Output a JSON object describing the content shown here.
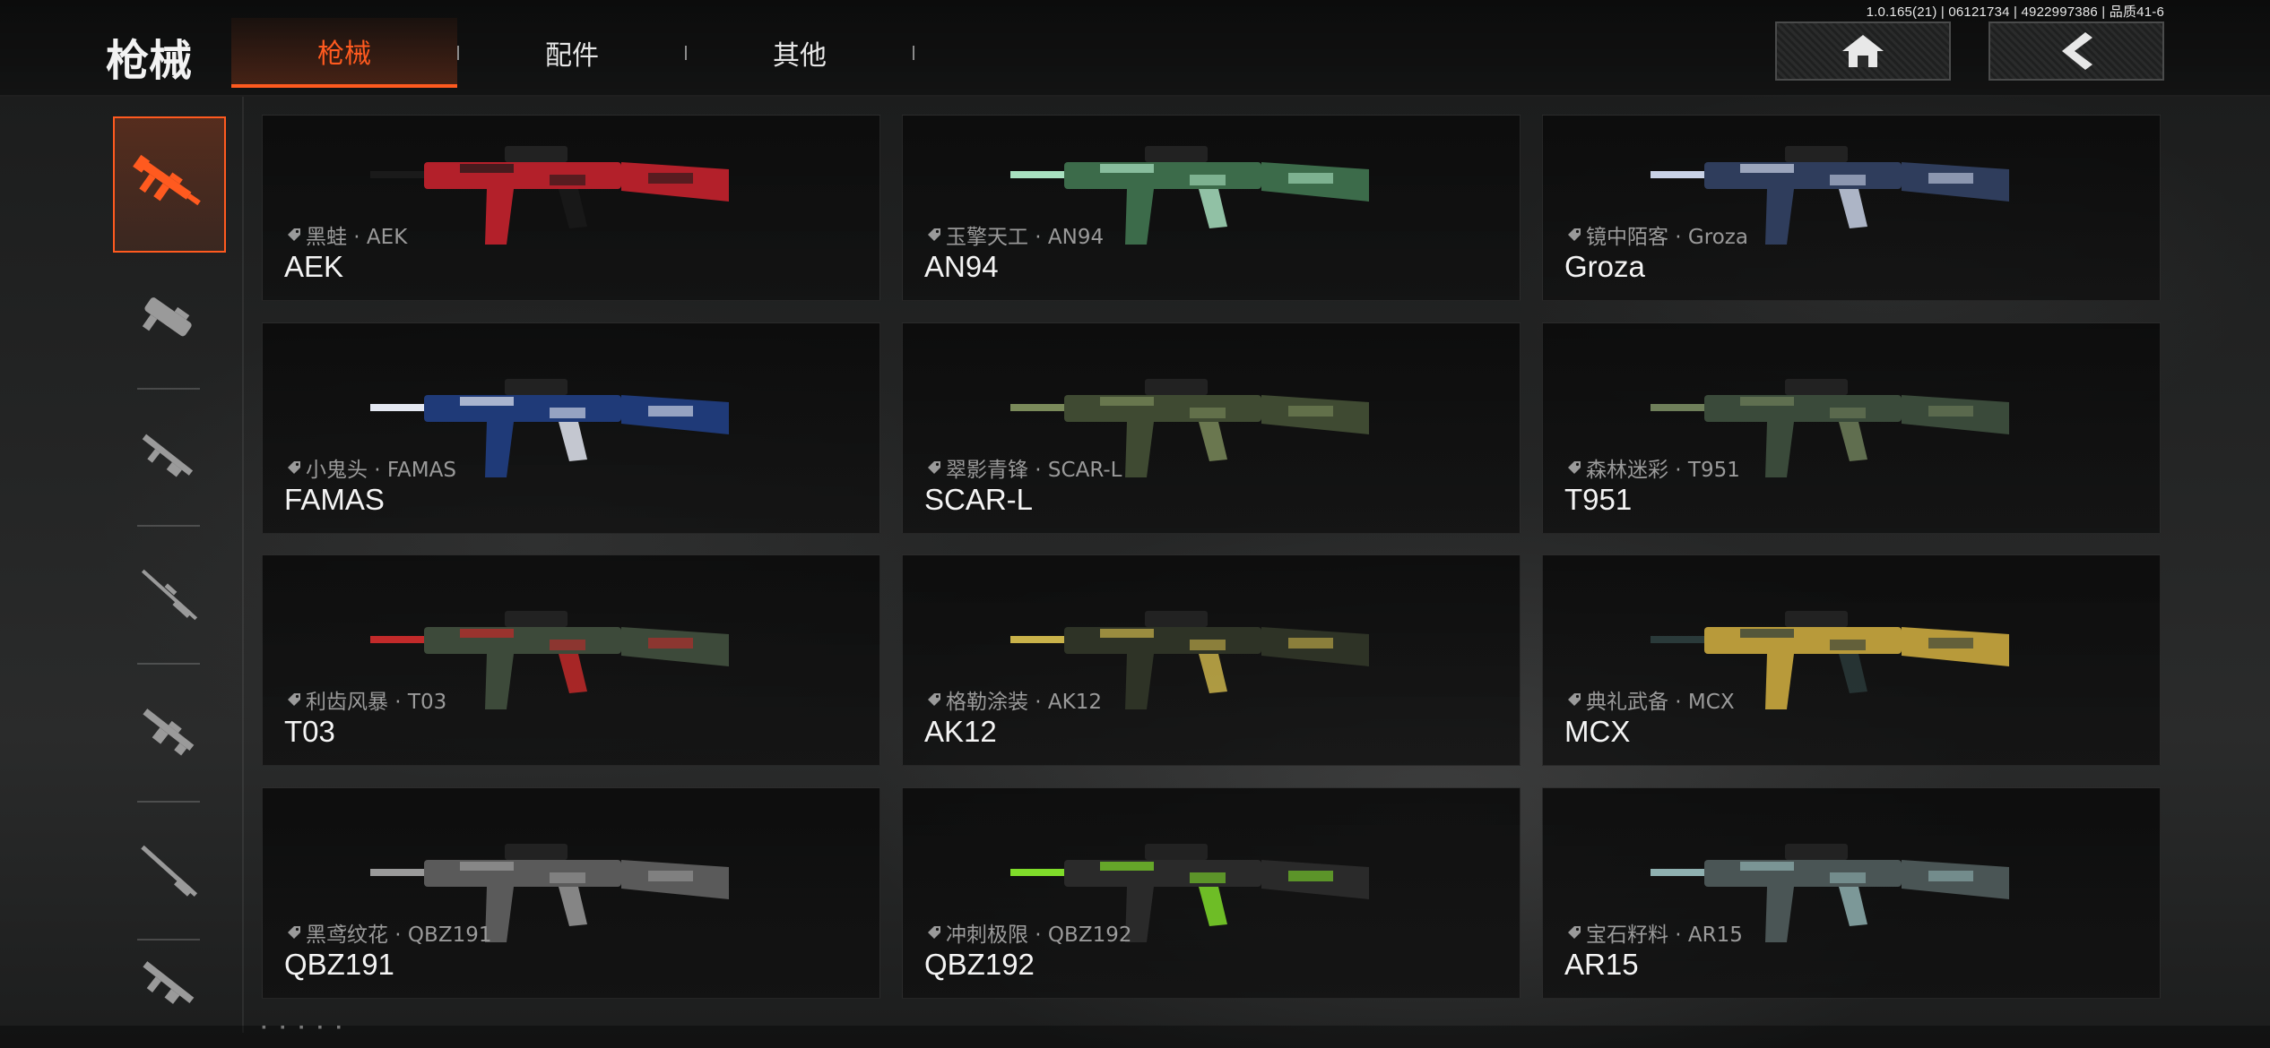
{
  "version": "1.0.165(21) | 06121734 | 4922997386 | 品质41-6",
  "header": {
    "title": "枪械",
    "tabs": [
      {
        "label": "枪械",
        "active": true
      },
      {
        "label": "配件",
        "active": false
      },
      {
        "label": "其他",
        "active": false
      }
    ],
    "home_icon": "home-icon",
    "back_icon": "chevron-left-icon"
  },
  "colors": {
    "accent": "#ff5a1f",
    "text": "#f4f4f4",
    "muted": "#9a9a9a"
  },
  "sidebar": {
    "items": [
      {
        "icon": "assault-rifle-icon",
        "active": true
      },
      {
        "icon": "smg-icon",
        "active": false
      },
      {
        "icon": "carbine-icon",
        "active": false
      },
      {
        "icon": "sniper-rifle-icon",
        "active": false
      },
      {
        "icon": "lmg-icon",
        "active": false
      },
      {
        "icon": "shotgun-icon",
        "active": false
      },
      {
        "icon": "pistol-icon",
        "active": false
      }
    ]
  },
  "weapons": [
    {
      "skin": "黑蛙 · AEK",
      "name": "AEK",
      "palette": [
        "#b3202a",
        "#1a1a1a"
      ]
    },
    {
      "skin": "玉擎天工 · AN94",
      "name": "AN94",
      "palette": [
        "#3c6b4a",
        "#a8e0c0"
      ]
    },
    {
      "skin": "镜中陌客 · Groza",
      "name": "Groza",
      "palette": [
        "#2f3d5c",
        "#c9d2e6"
      ]
    },
    {
      "skin": "小鬼头 · FAMAS",
      "name": "FAMAS",
      "palette": [
        "#1f3a78",
        "#e4e8f2"
      ]
    },
    {
      "skin": "翠影青锋 · SCAR-L",
      "name": "SCAR-L",
      "palette": [
        "#3f4a32",
        "#7a8a5a"
      ]
    },
    {
      "skin": "森林迷彩 · T951",
      "name": "T951",
      "palette": [
        "#3a4a3a",
        "#6f7f5a"
      ]
    },
    {
      "skin": "利齿风暴 · T03",
      "name": "T03",
      "palette": [
        "#3d4a3a",
        "#c22a2a"
      ]
    },
    {
      "skin": "格勒涂装 · AK12",
      "name": "AK12",
      "palette": [
        "#2e3326",
        "#c9b24a"
      ]
    },
    {
      "skin": "典礼武备 · MCX",
      "name": "MCX",
      "palette": [
        "#b89a3a",
        "#2a3a3a"
      ]
    },
    {
      "skin": "黑鸢纹花 · QBZ191",
      "name": "QBZ191",
      "palette": [
        "#5a5a5a",
        "#9a9a9a"
      ]
    },
    {
      "skin": "冲刺极限 · QBZ192",
      "name": "QBZ192",
      "palette": [
        "#2a2a2a",
        "#7fdc2a"
      ]
    },
    {
      "skin": "宝石籽料 · AR15",
      "name": "AR15",
      "palette": [
        "#4a5555",
        "#8fb0b0"
      ]
    }
  ]
}
